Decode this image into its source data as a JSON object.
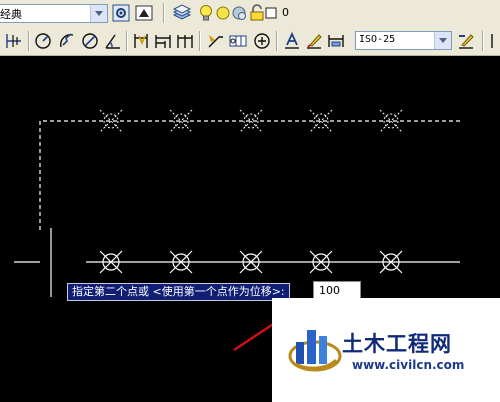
{
  "toolbar": {
    "workspace_combo": "经典",
    "layer_value": "0",
    "dimstyle_combo": "ISO-25"
  },
  "command": {
    "prompt": "指定第二个点或 <使用第一个点作为位移>:",
    "input_value": "100"
  },
  "watermark": {
    "brand": "土木工程网",
    "url": "www.civilcn.com"
  },
  "colors": {
    "canvas": "#000000",
    "prompt_bg": "#101f74",
    "arrow": "#d01010",
    "brand": "#0f2a78"
  },
  "icons": [
    "layer-properties-icon",
    "lightbulb-icon",
    "sun-icon",
    "lock-icon",
    "color-swatch-icon",
    "arc-dimension-icon",
    "radius-dimension-icon",
    "diameter-dimension-icon",
    "angular-dimension-icon",
    "baseline-dimension-icon",
    "continue-dimension-icon",
    "tolerance-icon",
    "center-mark-icon",
    "dimension-edit-icon",
    "dimension-update-icon"
  ]
}
